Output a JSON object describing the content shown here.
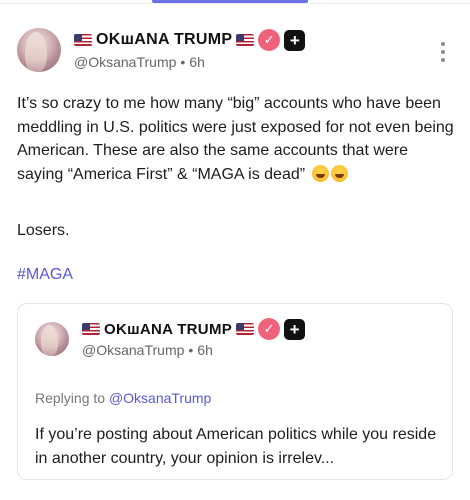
{
  "post": {
    "author": {
      "display_name_prefix_flag": "🇺🇸",
      "display_name": "OKшANA TRUMP",
      "display_name_suffix_flag": "🇺🇸",
      "handle": "@OksanaTrump",
      "separator": "•",
      "time_ago": "6h"
    },
    "body_text": "It’s so crazy to me how many “big” accounts who have been meddling in U.S. politics were just exposed for not even being American. These are also the same accounts that were saying “America First” & “MAGA is dead”",
    "emojis": [
      "😆",
      "😂"
    ],
    "second_paragraph": "Losers.",
    "hashtag": "#MAGA",
    "quoted_post": {
      "author": {
        "display_name": "OKшANA TRUMP",
        "handle": "@OksanaTrump",
        "separator": "•",
        "time_ago": "6h"
      },
      "replying_prefix": "Replying to",
      "replying_to": "@OksanaTrump",
      "text": "If you’re posting about American politics while you reside in another country, your opinion is irrelev..."
    }
  },
  "icons": {
    "verified": "verified-badge-icon",
    "plus": "plus-badge-icon",
    "more": "more-vertical-icon"
  },
  "colors": {
    "accent": "#5b57d9",
    "verified_badge": "#f0627a",
    "handle_gray": "#666666"
  }
}
